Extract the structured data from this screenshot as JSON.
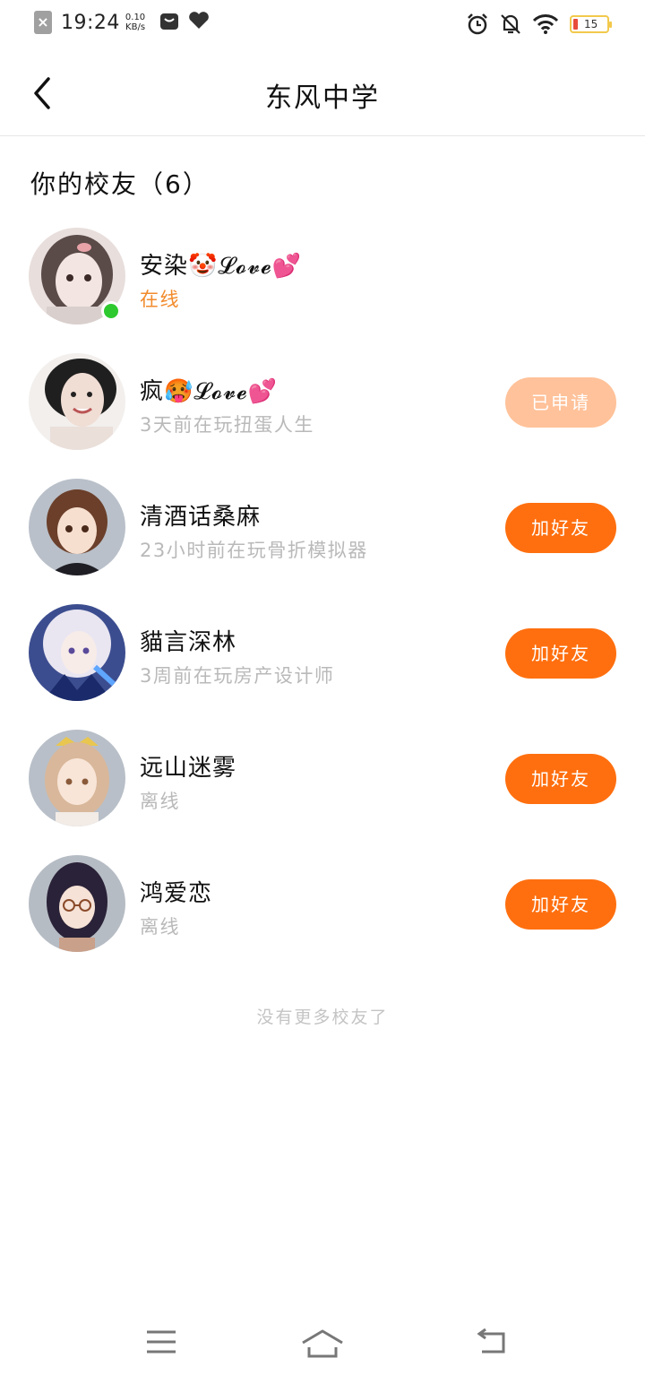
{
  "status_bar": {
    "time": "19:24",
    "speed_value": "0.10",
    "speed_unit": "KB/s",
    "battery": "15",
    "battery_level": 0.15
  },
  "header": {
    "title": "东风中学"
  },
  "section": {
    "title": "你的校友（6）"
  },
  "alumni": [
    {
      "name": "安染🤡𝓛𝓸𝓿𝓮💕",
      "status": "在线",
      "online": true,
      "action": ""
    },
    {
      "name": "疯🥵𝓛𝓸𝓿𝓮💕",
      "status": "3天前在玩扭蛋人生",
      "online": false,
      "action": "已申请"
    },
    {
      "name": "清酒话桑麻",
      "status": "23小时前在玩骨折模拟器",
      "online": false,
      "action": "加好友"
    },
    {
      "name": "貓言深林",
      "status": "3周前在玩房产设计师",
      "online": false,
      "action": "加好友"
    },
    {
      "name": "远山迷雾",
      "status": "离线",
      "online": false,
      "action": "加好友"
    },
    {
      "name": "鸿爱恋",
      "status": "离线",
      "online": false,
      "action": "加好友"
    }
  ],
  "footer_note": "没有更多校友了",
  "colors": {
    "accent": "#ff6f0f",
    "accent_disabled": "#ffc29a",
    "online_text": "#f28b2c",
    "online_dot": "#2ec92e"
  }
}
